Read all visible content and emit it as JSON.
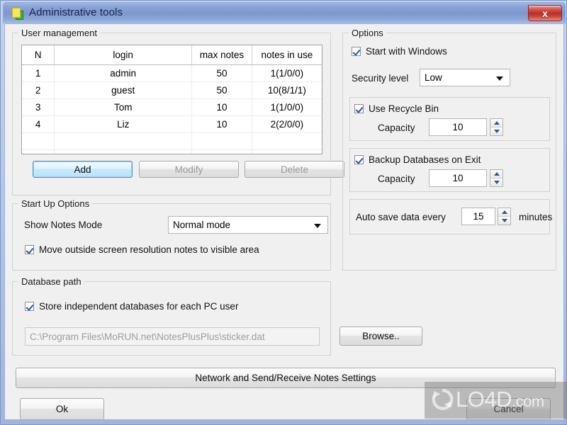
{
  "window": {
    "title": "Administrative tools",
    "icon": "notes-icon",
    "close_label": "x"
  },
  "user_management": {
    "legend": "User management",
    "columns": [
      "N",
      "login",
      "max notes",
      "notes in use"
    ],
    "rows": [
      {
        "n": "1",
        "login": "admin",
        "max_notes": "50",
        "notes_in_use": "1(1/0/0)"
      },
      {
        "n": "2",
        "login": "guest",
        "max_notes": "50",
        "notes_in_use": "10(8/1/1)"
      },
      {
        "n": "3",
        "login": "Tom",
        "max_notes": "10",
        "notes_in_use": "1(1/0/0)"
      },
      {
        "n": "4",
        "login": "Liz",
        "max_notes": "10",
        "notes_in_use": "2(2/0/0)"
      }
    ],
    "buttons": {
      "add": "Add",
      "modify": "Modify",
      "delete": "Delete"
    }
  },
  "start_up_options": {
    "legend": "Start Up Options",
    "show_notes_mode_label": "Show Notes Mode",
    "show_notes_mode_value": "Normal mode",
    "move_outside_label": "Move outside screen resolution notes to visible area"
  },
  "options": {
    "legend": "Options",
    "start_with_windows_label": "Start with Windows",
    "security_level_label": "Security level",
    "security_level_value": "Low",
    "recycle_bin_label": "Use Recycle Bin",
    "recycle_bin_capacity_label": "Capacity",
    "recycle_bin_capacity_value": "10",
    "backup_label": "Backup Databases on Exit",
    "backup_capacity_label": "Capacity",
    "backup_capacity_value": "10",
    "autosave_prefix": "Auto save data every",
    "autosave_value": "15",
    "autosave_suffix": "minutes"
  },
  "database_path": {
    "legend": "Database path",
    "store_independent_label": "Store independent databases for each PC user",
    "path_value": "C:\\Program Files\\MoRUN.net\\NotesPlusPlus\\sticker.dat",
    "browse_label": "Browse.."
  },
  "footer": {
    "network_button": "Network and Send/Receive Notes Settings",
    "ok_button": "Ok",
    "cancel_button": "Cancel"
  },
  "watermark": {
    "text": "LO4D",
    "suffix": ".com"
  }
}
